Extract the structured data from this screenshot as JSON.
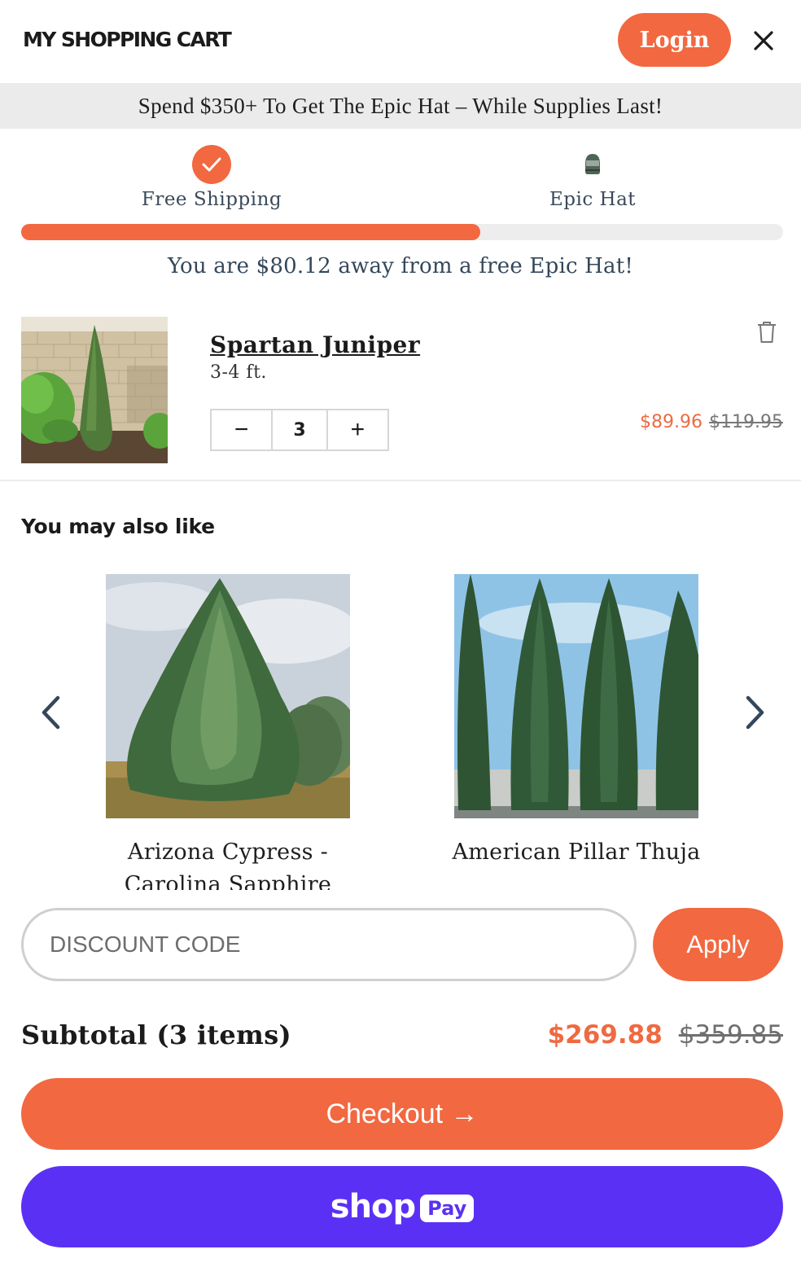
{
  "header": {
    "title": "MY SHOPPING CART",
    "login_label": "Login",
    "close_icon": "close-icon"
  },
  "promo": {
    "text": "Spend $350+ To Get The Epic Hat – While Supplies Last!"
  },
  "rewards": {
    "milestones": [
      {
        "label": "Free Shipping",
        "icon": "check-icon",
        "achieved": true
      },
      {
        "label": "Epic Hat",
        "icon": "hat-icon",
        "achieved": false
      }
    ],
    "progress_fraction": 0.603,
    "away_text": "You are $80.12 away from a free Epic Hat!",
    "accent_color": "#f26840"
  },
  "cart_item": {
    "name": "Spartan Juniper",
    "variant": "3-4 ft.",
    "quantity": "3",
    "minus_label": "−",
    "plus_label": "+",
    "sale_price": "$89.96",
    "original_price": "$119.95",
    "trash_icon": "trash-icon"
  },
  "recommendations": {
    "heading": "You may also like",
    "items": [
      {
        "title": "Arizona Cypress - Carolina Sapphire"
      },
      {
        "title": "American Pillar Thuja"
      }
    ],
    "prev_icon": "chevron-left-icon",
    "next_icon": "chevron-right-icon"
  },
  "discount": {
    "placeholder": "DISCOUNT CODE",
    "apply_label": "Apply"
  },
  "summary": {
    "subtotal_label": "Subtotal (3 items)",
    "subtotal_sale": "$269.88",
    "subtotal_original": "$359.85"
  },
  "actions": {
    "checkout_label": "Checkout →",
    "shop_word": "shop",
    "pay_badge": "Pay",
    "shoppay_color": "#5a31f4"
  }
}
